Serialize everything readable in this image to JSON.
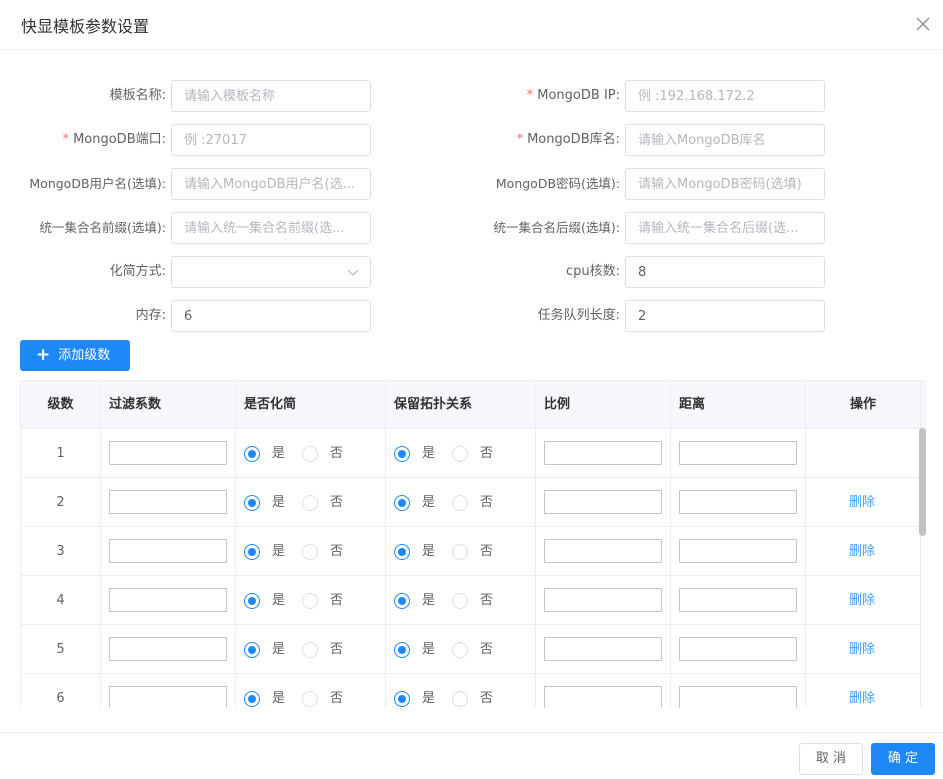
{
  "dialog": {
    "title": "快显模板参数设置"
  },
  "form": {
    "template_name": {
      "label": "模板名称:",
      "placeholder": "请输入模板名称",
      "value": ""
    },
    "mongo_ip": {
      "required": "*",
      "label": "MongoDB IP:",
      "placeholder": "例 :192.168.172.2",
      "value": ""
    },
    "mongo_port": {
      "required": "*",
      "label": "MongoDB端口:",
      "placeholder": "例 :27017",
      "value": ""
    },
    "mongo_db": {
      "required": "*",
      "label": "MongoDB库名:",
      "placeholder": "请输入MongoDB库名",
      "value": ""
    },
    "mongo_user": {
      "label": "MongoDB用户名(选填):",
      "placeholder": "请输入MongoDB用户名(选...",
      "value": ""
    },
    "mongo_pass": {
      "label": "MongoDB密码(选填):",
      "placeholder": "请输入MongoDB密码(选填)",
      "value": ""
    },
    "prefix": {
      "label": "统一集合名前缀(选填):",
      "placeholder": "请输入统一集合名前缀(选...",
      "value": ""
    },
    "suffix": {
      "label": "统一集合名后缀(选填):",
      "placeholder": "请输入统一集合名后缀(选...",
      "value": ""
    },
    "simplify_method": {
      "label": "化简方式:",
      "value": ""
    },
    "cpu_cores": {
      "label": "cpu核数:",
      "value": "8"
    },
    "memory": {
      "label": "内存:",
      "value": "6"
    },
    "queue_length": {
      "label": "任务队列长度:",
      "value": "2"
    }
  },
  "add_level_button": {
    "icon": "plus-icon",
    "label": "添加级数"
  },
  "table": {
    "columns": [
      "级数",
      "过滤系数",
      "是否化简",
      "保留拓扑关系",
      "比例",
      "距离",
      "操作"
    ],
    "radio_yes": "是",
    "radio_no": "否",
    "delete_label": "删除",
    "rows": [
      {
        "level": "1",
        "simplify": "yes",
        "topology": "yes",
        "deletable": false
      },
      {
        "level": "2",
        "simplify": "yes",
        "topology": "yes",
        "deletable": true
      },
      {
        "level": "3",
        "simplify": "yes",
        "topology": "yes",
        "deletable": true
      },
      {
        "level": "4",
        "simplify": "yes",
        "topology": "yes",
        "deletable": true
      },
      {
        "level": "5",
        "simplify": "yes",
        "topology": "yes",
        "deletable": true
      },
      {
        "level": "6",
        "simplify": "yes",
        "topology": "yes",
        "deletable": true
      }
    ]
  },
  "footer": {
    "cancel_label": "取 消",
    "confirm_label": "确 定"
  },
  "colors": {
    "primary": "#1e88f7",
    "link": "#409eff",
    "required": "#f56c6c"
  }
}
